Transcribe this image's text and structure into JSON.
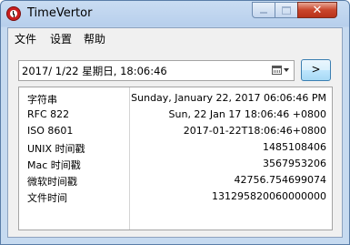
{
  "window": {
    "title": "TimeVertor"
  },
  "menu": {
    "items": [
      "文件",
      "设置",
      "帮助"
    ]
  },
  "datepicker": {
    "value": "2017/  1/22 星期日, 18:06:46",
    "icon": "calendar-icon"
  },
  "go_button": {
    "label": ">"
  },
  "results": {
    "rows": [
      {
        "key": "字符串",
        "value": "Sunday, January 22, 2017 06:06:46 PM"
      },
      {
        "key": "RFC 822",
        "value": "Sun, 22 Jan 17 18:06:46 +0800"
      },
      {
        "key": "ISO 8601",
        "value": "2017-01-22T18:06:46+0800"
      },
      {
        "key": "UNIX 时间戳",
        "value": "1485108406"
      },
      {
        "key": "Mac 时间戳",
        "value": "3567953206"
      },
      {
        "key": "微软时间戳",
        "value": "42756.754699074"
      },
      {
        "key": "文件时间",
        "value": "131295820060000000"
      }
    ]
  }
}
